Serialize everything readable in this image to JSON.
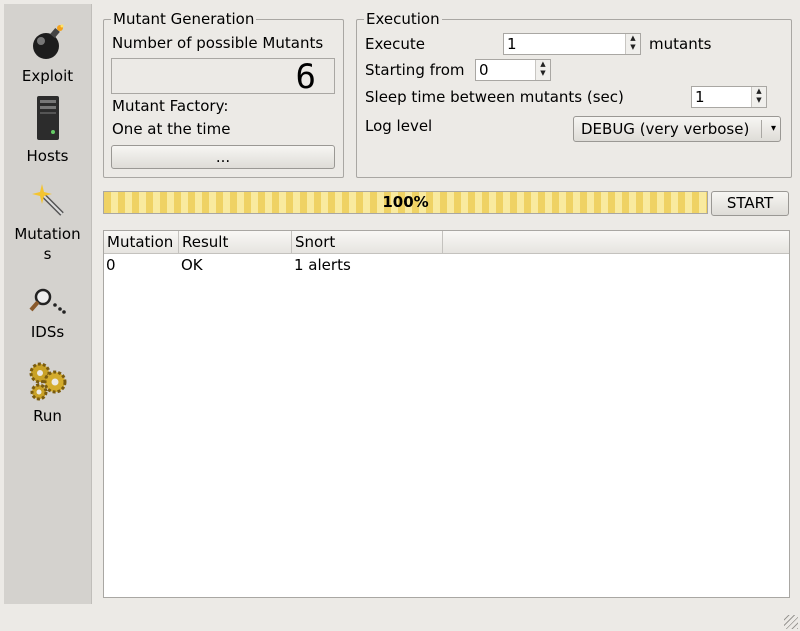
{
  "sidebar": {
    "items": [
      {
        "label": "Exploit",
        "icon": "bomb-icon"
      },
      {
        "label": "Hosts",
        "icon": "server-icon"
      },
      {
        "label": "Mutation\ns",
        "icon": "magic-wand-icon"
      },
      {
        "label": "IDSs",
        "icon": "magnifier-icon"
      },
      {
        "label": "Run",
        "icon": "gears-icon"
      }
    ]
  },
  "mutant_generation": {
    "title": "Mutant Generation",
    "possible_label": "Number of possible Mutants",
    "possible_count": "6",
    "factory_label": "Mutant Factory:",
    "factory_value": "One at the time",
    "factory_button": "..."
  },
  "execution": {
    "title": "Execution",
    "execute_label": "Execute",
    "execute_value": "1",
    "execute_suffix": "mutants",
    "starting_label": "Starting from",
    "starting_value": "0",
    "sleep_label": "Sleep time between mutants (sec)",
    "sleep_value": "1",
    "log_label": "Log level",
    "log_value": "DEBUG (very verbose)"
  },
  "progress": {
    "text": "100%",
    "fraction": 1.0
  },
  "start_button": "START",
  "table": {
    "columns": [
      "Mutation",
      "Result",
      "Snort"
    ],
    "rows": [
      [
        "0",
        "OK",
        "1 alerts"
      ]
    ]
  },
  "colors": {
    "progress_light": "#f8e8a2",
    "progress_dark": "#f0d56f",
    "window_bg": "#eceae6",
    "sidebar_bg": "#d4d2ce"
  }
}
